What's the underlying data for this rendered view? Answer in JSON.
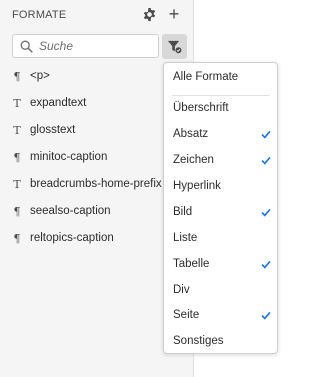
{
  "panel": {
    "title": "FORMATE",
    "search_placeholder": "Suche",
    "icons": {
      "settings": "gear-icon",
      "add": "plus-icon",
      "search": "search-icon",
      "filter": "filter-icon"
    }
  },
  "styles": [
    {
      "glyph": "¶",
      "type": "paragraph",
      "label": "<p>"
    },
    {
      "glyph": "T",
      "type": "character",
      "label": "expandtext"
    },
    {
      "glyph": "T",
      "type": "character",
      "label": "glosstext"
    },
    {
      "glyph": "¶",
      "type": "paragraph",
      "label": "minitoc-caption"
    },
    {
      "glyph": "T",
      "type": "character",
      "label": "breadcrumbs-home-prefix"
    },
    {
      "glyph": "¶",
      "type": "paragraph",
      "label": "seealso-caption"
    },
    {
      "glyph": "¶",
      "type": "paragraph",
      "label": "reltopics-caption"
    }
  ],
  "filter_menu": {
    "all_label": "Alle Formate",
    "items": [
      {
        "label": "Überschrift",
        "checked": false
      },
      {
        "label": "Absatz",
        "checked": true
      },
      {
        "label": "Zeichen",
        "checked": true
      },
      {
        "label": "Hyperlink",
        "checked": false
      },
      {
        "label": "Bild",
        "checked": true
      },
      {
        "label": "Liste",
        "checked": false
      },
      {
        "label": "Tabelle",
        "checked": true
      },
      {
        "label": "Div",
        "checked": false
      },
      {
        "label": "Seite",
        "checked": true
      },
      {
        "label": "Sonstiges",
        "checked": false
      }
    ]
  },
  "colors": {
    "accent": "#1473e6",
    "panel_bg": "#f5f5f5",
    "text": "#2c2c2c"
  }
}
